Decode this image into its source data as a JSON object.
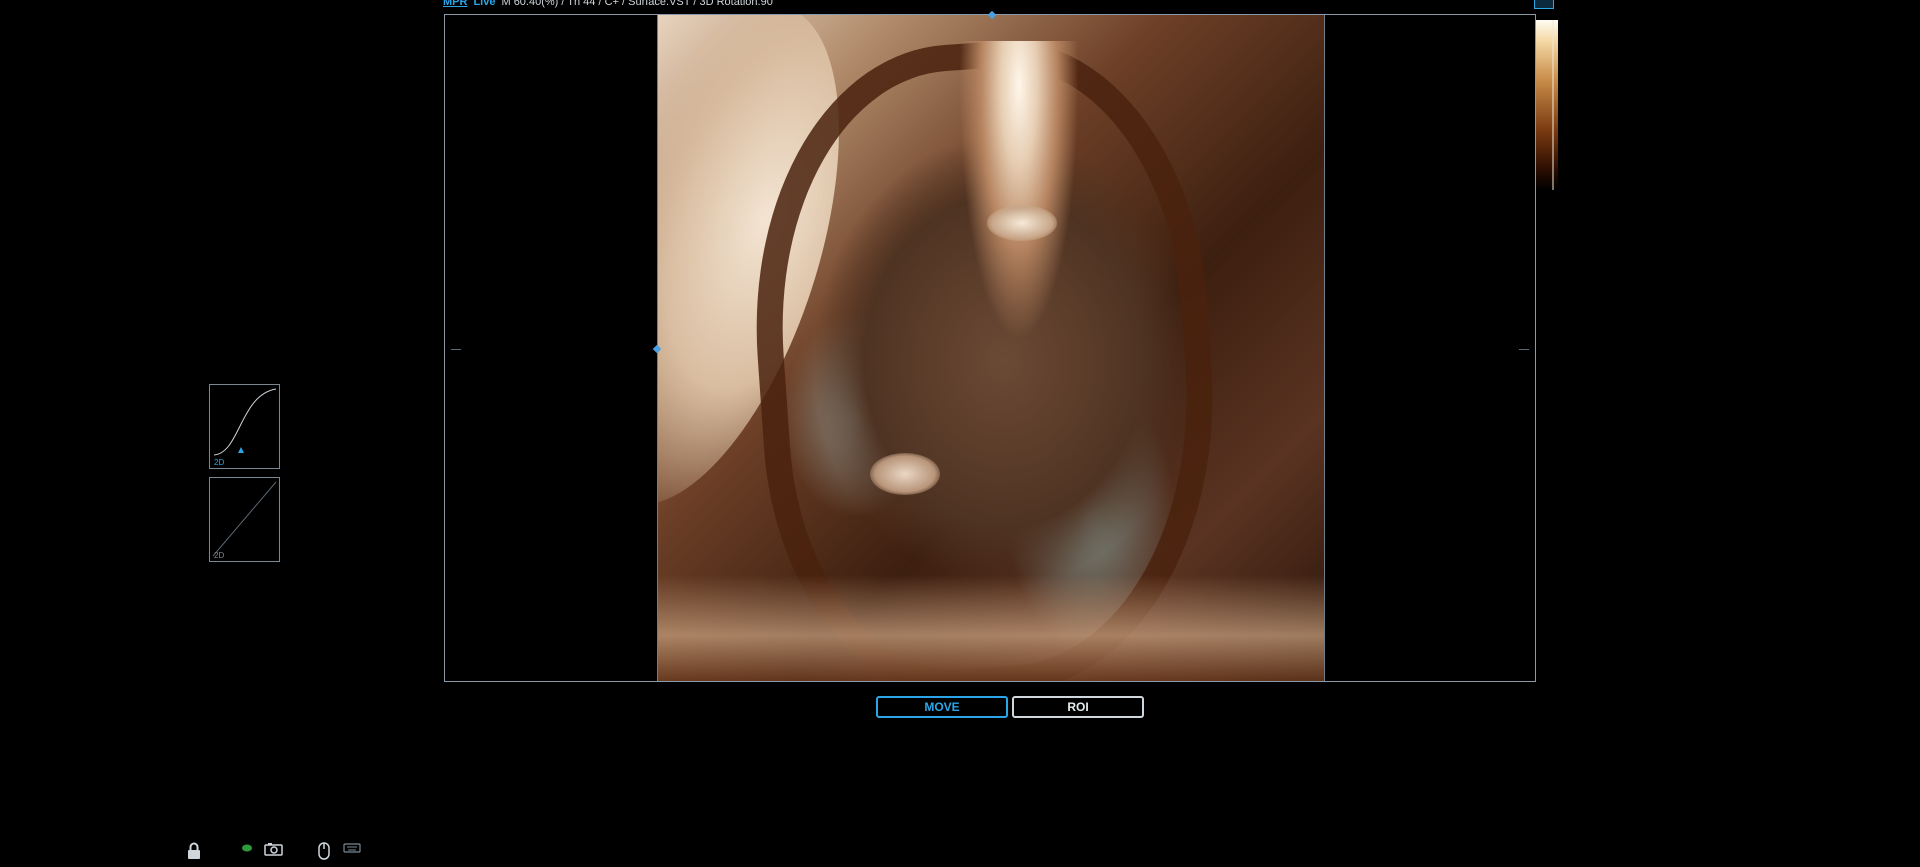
{
  "header": {
    "mode_tag": "MPR",
    "live_tag": "Live",
    "info": "M 60.40(%) / Th 44 / C+ / Surface.VST / 3D Rotation.90"
  },
  "viewport": {
    "render": "3d-surface-volume"
  },
  "buttons": {
    "move": "MOVE",
    "roi": "ROI"
  },
  "curves": {
    "thumb1_label": "2D",
    "thumb2_label": "2D"
  },
  "icons": {
    "lock": "lock-icon",
    "camera": "camera-icon",
    "mouse": "mouse-icon",
    "keyboard": "keyboard-icon"
  },
  "colors": {
    "accent": "#2aa6e8",
    "frame": "#8a9aa8"
  }
}
